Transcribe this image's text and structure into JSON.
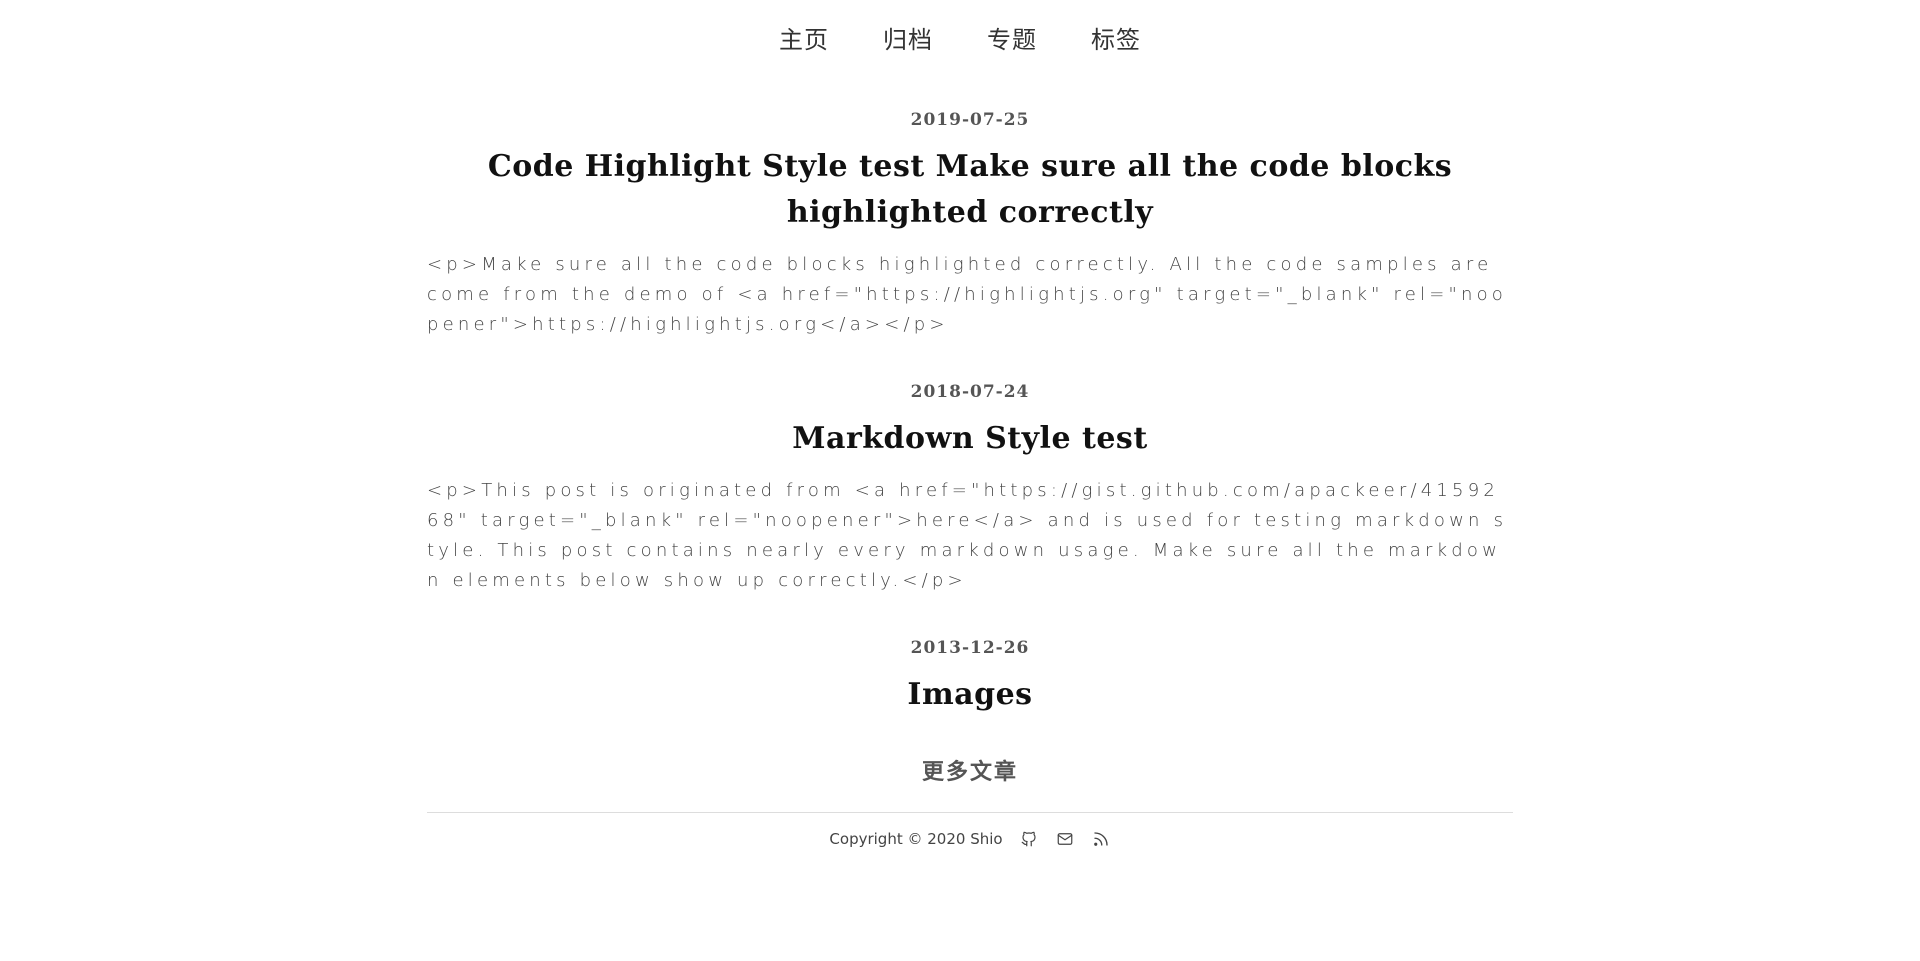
{
  "nav": {
    "items": [
      {
        "label": "主页"
      },
      {
        "label": "归档"
      },
      {
        "label": "专题"
      },
      {
        "label": "标签"
      }
    ]
  },
  "posts": [
    {
      "date": "2019-07-25",
      "title": "Code Highlight Style test Make sure all the code blocks highlighted correctly",
      "excerpt": "<p>Make sure all the code blocks highlighted correctly. All the code samples are come from the demo of <a href=\"https://highlightjs.org\" target=\"_blank\" rel=\"noopener\">https://highlightjs.org</a></p>"
    },
    {
      "date": "2018-07-24",
      "title": "Markdown Style test",
      "excerpt": "<p>This post is originated from <a href=\"https://gist.github.com/apackeer/4159268\" target=\"_blank\" rel=\"noopener\">here</a> and is used for testing markdown style. This post contains nearly every markdown usage. Make sure all the markdown elements below show up correctly.</p>"
    },
    {
      "date": "2013-12-26",
      "title": "Images",
      "excerpt": ""
    }
  ],
  "more_label": "更多文章",
  "footer": {
    "copyright": "Copyright © 2020 Shio",
    "icons": [
      "github-icon",
      "mail-icon",
      "rss-icon"
    ]
  }
}
